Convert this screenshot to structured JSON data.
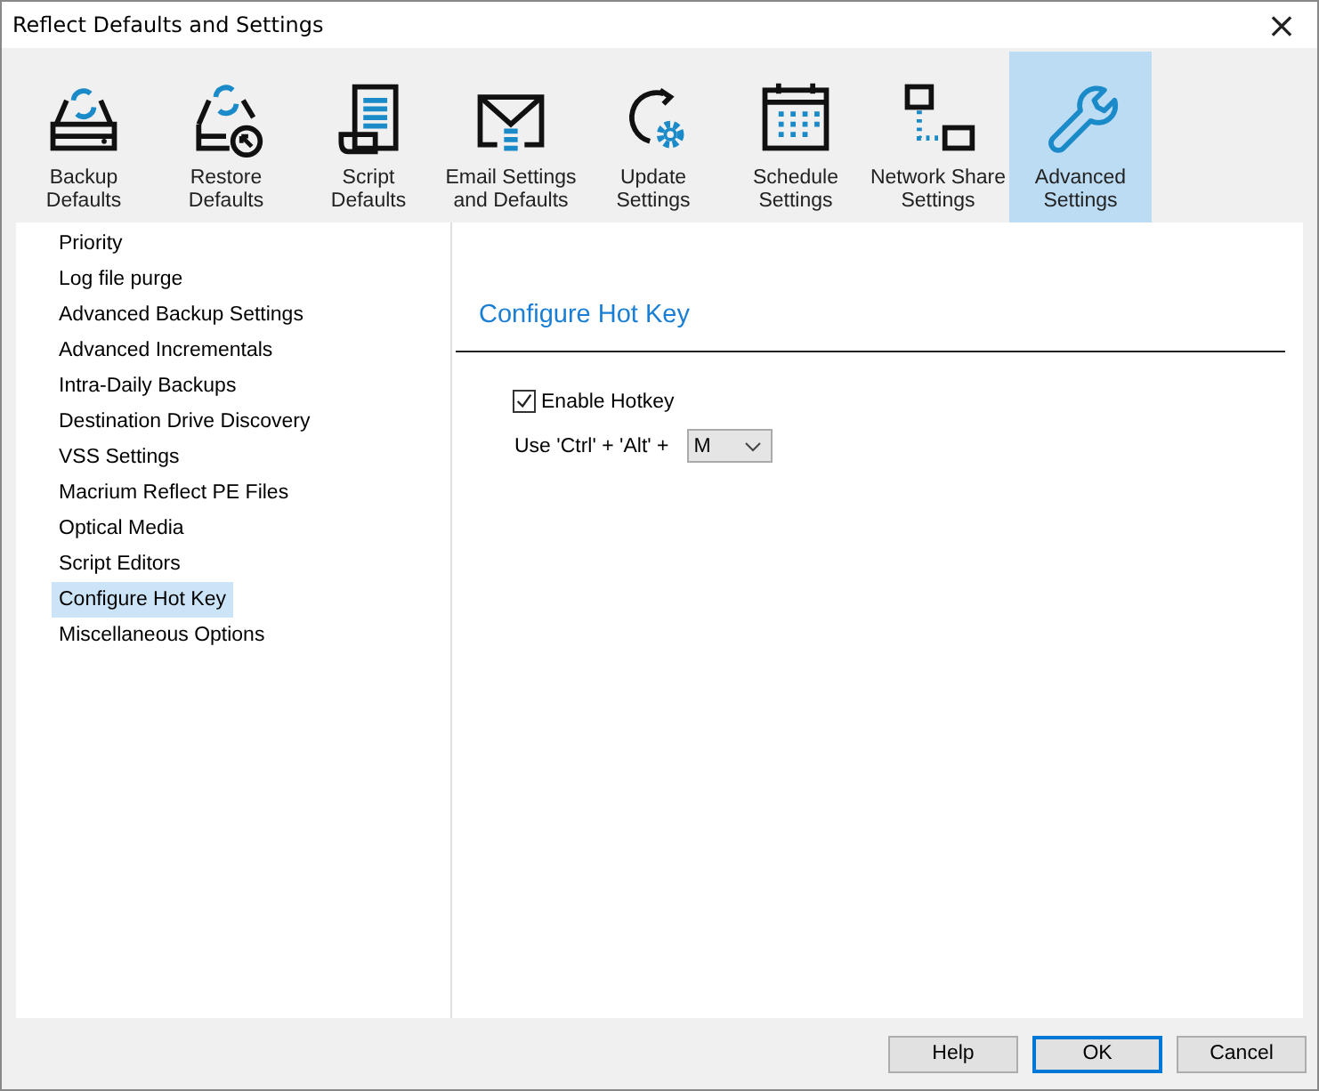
{
  "window": {
    "title": "Reflect Defaults and Settings",
    "close": "×"
  },
  "tabs": [
    {
      "label": "Backup\nDefaults",
      "selected": false
    },
    {
      "label": "Restore\nDefaults",
      "selected": false
    },
    {
      "label": "Script\nDefaults",
      "selected": false
    },
    {
      "label": "Email Settings\nand Defaults",
      "selected": false
    },
    {
      "label": "Update\nSettings",
      "selected": false
    },
    {
      "label": "Schedule\nSettings",
      "selected": false
    },
    {
      "label": "Network Share\nSettings",
      "selected": false
    },
    {
      "label": "Advanced\nSettings",
      "selected": true
    }
  ],
  "sidebar": {
    "items": [
      {
        "label": "Priority",
        "selected": false
      },
      {
        "label": "Log file purge",
        "selected": false
      },
      {
        "label": "Advanced Backup Settings",
        "selected": false
      },
      {
        "label": "Advanced Incrementals",
        "selected": false
      },
      {
        "label": "Intra-Daily Backups",
        "selected": false
      },
      {
        "label": "Destination Drive Discovery",
        "selected": false
      },
      {
        "label": "VSS Settings",
        "selected": false
      },
      {
        "label": "Macrium Reflect PE Files",
        "selected": false
      },
      {
        "label": "Optical Media",
        "selected": false
      },
      {
        "label": "Script Editors",
        "selected": false
      },
      {
        "label": "Configure Hot Key",
        "selected": true
      },
      {
        "label": "Miscellaneous Options",
        "selected": false
      }
    ]
  },
  "content": {
    "heading": "Configure Hot Key",
    "enable": {
      "label": "Enable Hotkey",
      "checked": true
    },
    "hotkey": {
      "label": "Use 'Ctrl' + 'Alt' +",
      "value": "M"
    }
  },
  "buttons": [
    {
      "label": "Help",
      "default": false
    },
    {
      "label": "OK",
      "default": true
    },
    {
      "label": "Cancel",
      "default": false
    }
  ]
}
